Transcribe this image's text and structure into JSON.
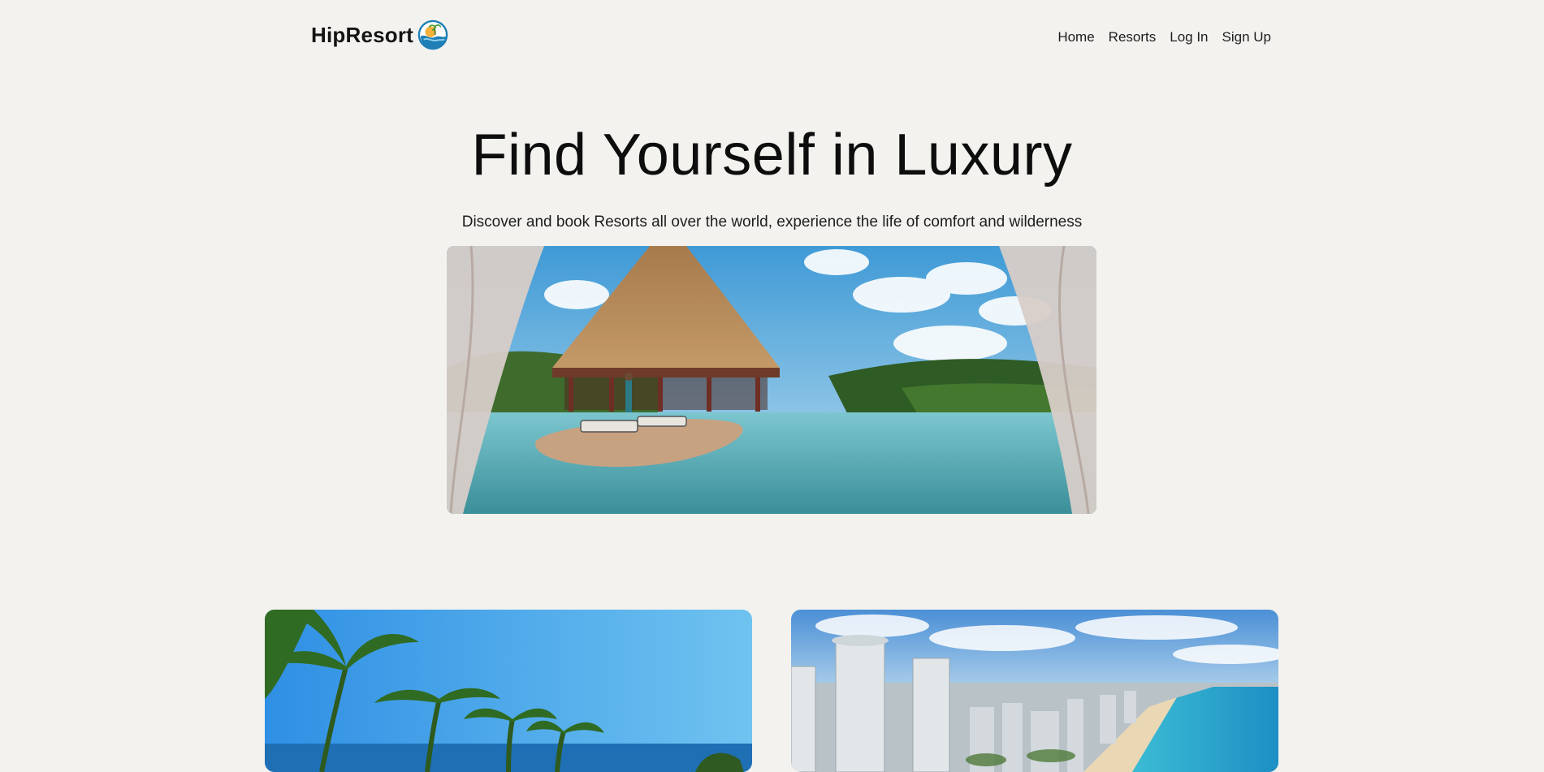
{
  "brand": {
    "name": "HipResort",
    "logo_icon": "island-sun-wave-icon"
  },
  "nav": {
    "items": [
      {
        "label": "Home"
      },
      {
        "label": "Resorts"
      },
      {
        "label": "Log In"
      },
      {
        "label": "Sign Up"
      }
    ]
  },
  "hero": {
    "title": "Find Yourself in Luxury",
    "subtitle": "Discover and book Resorts all over the world, experience the life of comfort and wilderness",
    "image": "luxury-infinity-pool-thatched-pavilion-photo"
  },
  "cards": [
    {
      "image": "tropical-palms-sea-photo"
    },
    {
      "image": "city-skyline-beach-photo"
    }
  ],
  "colors": {
    "background": "#f3f2ef",
    "text": "#111111",
    "logo_blue": "#1d7fb5",
    "logo_orange": "#f2a03a"
  }
}
